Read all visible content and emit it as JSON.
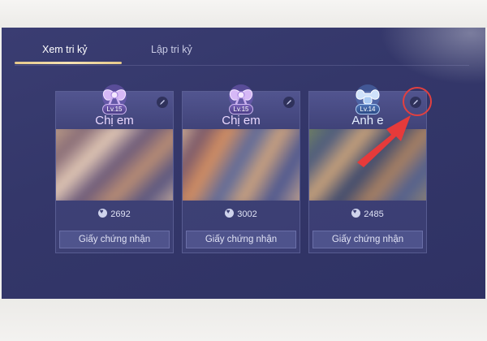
{
  "tabs": [
    {
      "label": "Xem tri kỷ",
      "active": true
    },
    {
      "label": "Lập tri kỷ",
      "active": false
    }
  ],
  "cards": [
    {
      "level": "Lv.15",
      "relation": "Chị em",
      "affinity": "2692",
      "button": "Giấy chứng nhận",
      "badge_icon": "bow-icon"
    },
    {
      "level": "Lv.15",
      "relation": "Chị em",
      "affinity": "3002",
      "button": "Giấy chứng nhận",
      "badge_icon": "bow-icon"
    },
    {
      "level": "Lv.14",
      "relation": "Anh e",
      "affinity": "2485",
      "button": "Giấy chứng nhận",
      "badge_icon": "muscle-icon"
    }
  ],
  "annotation": {
    "color": "#e24040",
    "shape": "circle-and-arrow"
  },
  "colors": {
    "screen_bg": "#34376a",
    "accent_gold": "#e6c98a"
  }
}
